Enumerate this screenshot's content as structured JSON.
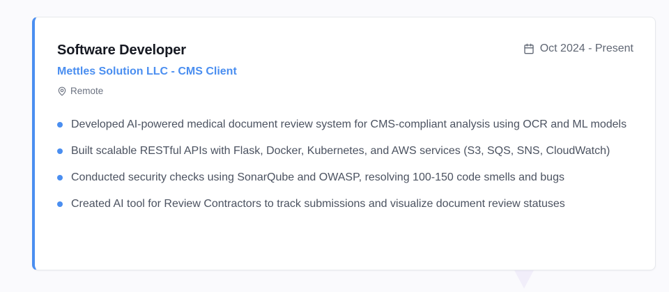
{
  "experience": {
    "title": "Software Developer",
    "company": "Mettles Solution LLC - CMS Client",
    "location": "Remote",
    "date_range": "Oct 2024 - Present",
    "bullets": [
      "Developed AI-powered medical document review system for CMS-compliant analysis using OCR and ML models",
      "Built scalable RESTful APIs with Flask, Docker, Kubernetes, and AWS services (S3, SQS, SNS, CloudWatch)",
      "Conducted security checks using SonarQube and OWASP, resolving 100-150 code smells and bugs",
      "Created AI tool for Review Contractors to track submissions and visualize document review statuses"
    ]
  },
  "icons": {
    "location": "map-pin-icon",
    "date": "calendar-icon",
    "bullet": "bullet-dot"
  },
  "colors": {
    "accent": "#4a8ef0",
    "title": "#151821",
    "body_text": "#4b5260",
    "muted_text": "#6b7280"
  }
}
